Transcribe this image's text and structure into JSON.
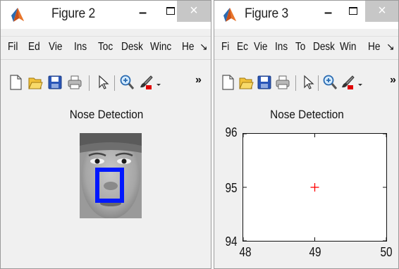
{
  "figure2": {
    "title": "Figure 2",
    "min_glyph": "–",
    "close_glyph": "×",
    "menu": [
      "Fil",
      "Ed",
      "Vie",
      "Ins",
      "Toc",
      "Desk",
      "Winc",
      "He"
    ],
    "menu_more": "↘",
    "toolbar_more": "»",
    "toolbar_icons": [
      "new-file-icon",
      "open-folder-icon",
      "save-icon",
      "print-icon",
      "pointer-icon",
      "zoom-in-icon",
      "brush-icon",
      "dropdown-arrow-icon"
    ],
    "axes_title": "Nose Detection",
    "image": "face-image",
    "detection_box_color": "#0018ff"
  },
  "figure3": {
    "title": "Figure 3",
    "min_glyph": "–",
    "close_glyph": "×",
    "menu": [
      "Fi",
      "Ec",
      "Vie",
      "Ins",
      "To",
      "Desk",
      "Win",
      "He"
    ],
    "menu_more": "↘",
    "toolbar_more": "»",
    "toolbar_icons": [
      "new-file-icon",
      "open-folder-icon",
      "save-icon",
      "print-icon",
      "pointer-icon",
      "zoom-in-icon",
      "brush-icon",
      "dropdown-arrow-icon"
    ],
    "axes_title": "Nose Detection"
  },
  "chart_data": {
    "type": "scatter",
    "title": "Nose Detection",
    "xlabel": "",
    "ylabel": "",
    "xlim": [
      48,
      50
    ],
    "ylim": [
      94,
      96
    ],
    "xticks": [
      "48",
      "49",
      "50"
    ],
    "yticks": [
      "96",
      "95",
      "94"
    ],
    "grid": false,
    "series": [
      {
        "marker": "+",
        "color": "#ff0000",
        "points": [
          {
            "x": 49,
            "y": 95
          }
        ]
      }
    ]
  }
}
